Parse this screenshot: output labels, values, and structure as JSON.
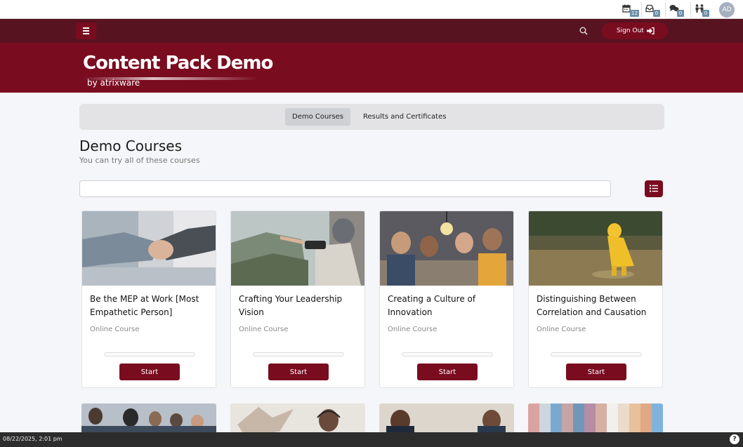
{
  "topbar": {
    "utilities": [
      {
        "icon": "calendar-icon",
        "count": "12"
      },
      {
        "icon": "inbox-icon",
        "count": "0"
      },
      {
        "icon": "chat-icon",
        "count": "0"
      },
      {
        "icon": "people-icon",
        "count": "0"
      }
    ],
    "avatar_initials": "AD"
  },
  "navbar": {
    "signout_label": "Sign Out"
  },
  "banner": {
    "title": "Content Pack Demo",
    "byline": "by atrixware"
  },
  "tabs": [
    {
      "label": "Demo Courses",
      "active": true
    },
    {
      "label": "Results and Certificates",
      "active": false
    }
  ],
  "main": {
    "title": "Demo Courses",
    "subtitle": "You can try all of these courses",
    "search_value": ""
  },
  "courses": [
    {
      "title": "Be the MEP at Work [Most Empathetic Person]",
      "type": "Online Course",
      "progress": 0,
      "button": "Start"
    },
    {
      "title": "Crafting Your Leadership Vision",
      "type": "Online Course",
      "progress": 0,
      "button": "Start"
    },
    {
      "title": "Creating a Culture of Innovation",
      "type": "Online Course",
      "progress": 0,
      "button": "Start"
    },
    {
      "title": "Distinguishing Between Correlation and Causation",
      "type": "Online Course",
      "progress": 0,
      "button": "Start"
    }
  ],
  "footer": {
    "timestamp": "08/22/2025, 2:01 pm",
    "help_label": "?"
  }
}
